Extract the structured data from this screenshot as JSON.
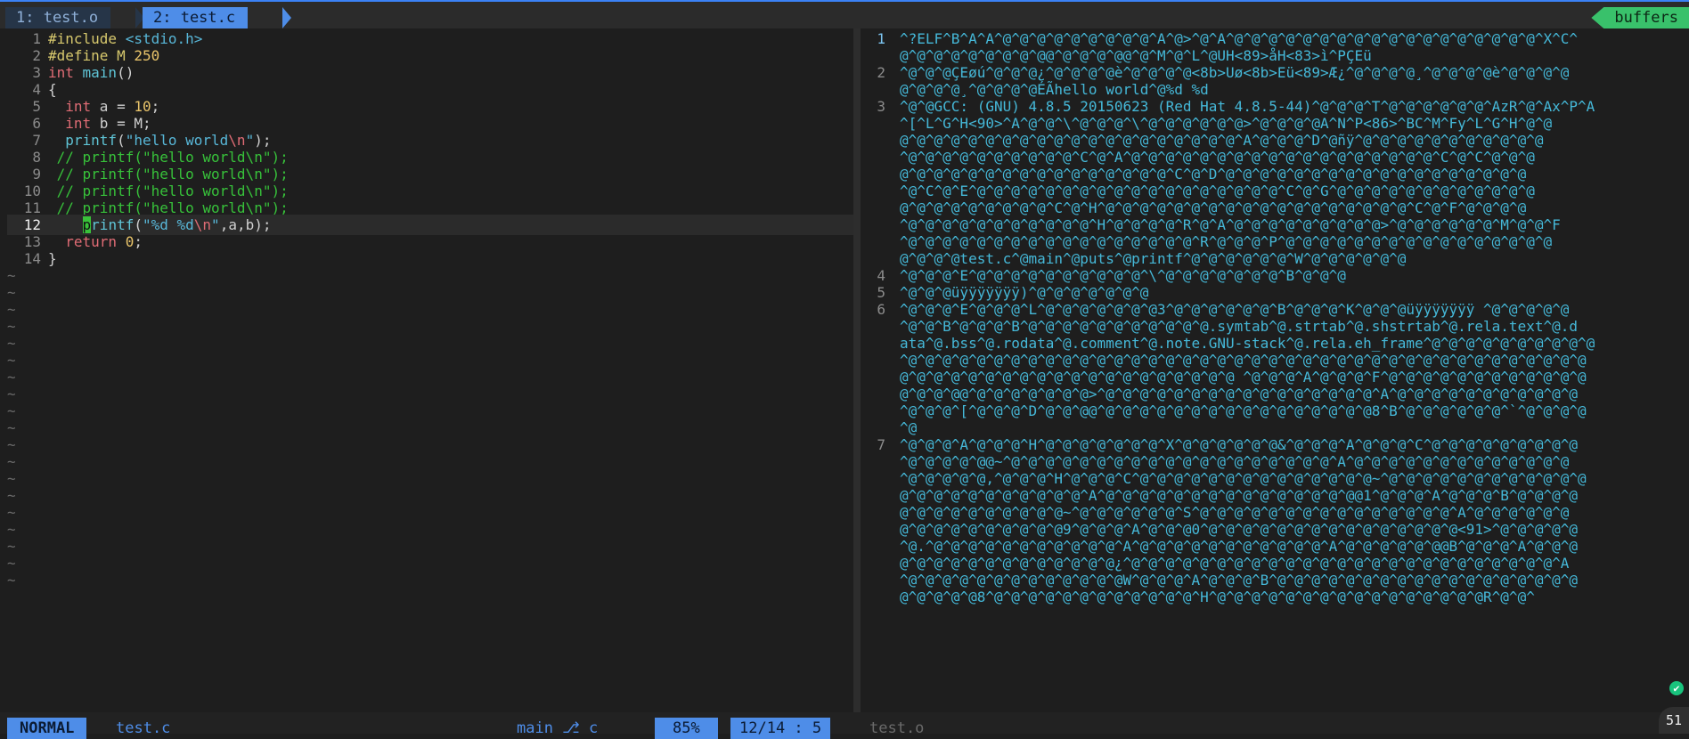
{
  "tabline": {
    "tab1_label": "1: test.o",
    "tab2_label": "2: test.c",
    "buffers_label": "buffers"
  },
  "left_pane": {
    "lines": [
      {
        "n": "1",
        "segs": [
          {
            "t": "#include ",
            "c": "pp"
          },
          {
            "t": "<stdio.h>",
            "c": "str"
          }
        ]
      },
      {
        "n": "2",
        "segs": [
          {
            "t": "#define M ",
            "c": "pp"
          },
          {
            "t": "250",
            "c": "num"
          }
        ]
      },
      {
        "n": "3",
        "segs": [
          {
            "t": "int ",
            "c": "kw"
          },
          {
            "t": "main",
            "c": "fn"
          },
          {
            "t": "()",
            "c": ""
          }
        ]
      },
      {
        "n": "4",
        "segs": [
          {
            "t": "{",
            "c": ""
          }
        ]
      },
      {
        "n": "5",
        "segs": [
          {
            "t": "  ",
            "c": ""
          },
          {
            "t": "int",
            "c": "kw"
          },
          {
            "t": " a = ",
            "c": ""
          },
          {
            "t": "10",
            "c": "num"
          },
          {
            "t": ";",
            "c": ""
          }
        ]
      },
      {
        "n": "6",
        "segs": [
          {
            "t": "  ",
            "c": ""
          },
          {
            "t": "int",
            "c": "kw"
          },
          {
            "t": " b = M;",
            "c": ""
          }
        ]
      },
      {
        "n": "7",
        "segs": [
          {
            "t": "  ",
            "c": ""
          },
          {
            "t": "printf",
            "c": "fn"
          },
          {
            "t": "(",
            "c": ""
          },
          {
            "t": "\"hello world",
            "c": "str"
          },
          {
            "t": "\\n",
            "c": "esc"
          },
          {
            "t": "\"",
            "c": "str"
          },
          {
            "t": ");",
            "c": ""
          }
        ]
      },
      {
        "n": "8",
        "segs": [
          {
            "t": " // printf(\"hello world\\n\");",
            "c": "cm"
          }
        ]
      },
      {
        "n": "9",
        "segs": [
          {
            "t": " // printf(\"hello world\\n\");",
            "c": "cm"
          }
        ]
      },
      {
        "n": "10",
        "segs": [
          {
            "t": " // printf(\"hello world\\n\");",
            "c": "cm"
          }
        ]
      },
      {
        "n": "11",
        "segs": [
          {
            "t": " // printf(\"hello world\\n\");",
            "c": "cm"
          }
        ]
      },
      {
        "n": "12",
        "cur": true,
        "segs": [
          {
            "t": "    ",
            "c": ""
          },
          {
            "t": "p",
            "c": "cur-block"
          },
          {
            "t": "rintf",
            "c": "fn"
          },
          {
            "t": "(",
            "c": ""
          },
          {
            "t": "\"%d %d",
            "c": "str"
          },
          {
            "t": "\\n",
            "c": "esc"
          },
          {
            "t": "\"",
            "c": "str"
          },
          {
            "t": ",a,b);",
            "c": ""
          }
        ]
      },
      {
        "n": "13",
        "segs": [
          {
            "t": "  ",
            "c": ""
          },
          {
            "t": "return ",
            "c": "kw"
          },
          {
            "t": "0",
            "c": "num"
          },
          {
            "t": ";",
            "c": ""
          }
        ]
      },
      {
        "n": "14",
        "segs": [
          {
            "t": "}",
            "c": ""
          }
        ]
      }
    ],
    "tilde_count": 19,
    "tilde_char": "~"
  },
  "right_pane": {
    "lines": [
      {
        "n": "1",
        "cur": true,
        "t": "^?ELF^B^A^A^@^@^@^@^@^@^@^@^@^A^@>^@^A^@^@^@^@^@^@^@^@^@^@^@^@^@^@^@^@^@^@^X^C^"
      },
      {
        "n": "",
        "t": "@^@^@^@^@^@^@^@^@@^@^@^@^@@^@^M^@^L^@UH<89>åH<83>ì^PÇEü"
      },
      {
        "n": "2",
        "t": "^@^@^@ÇEøú^@^@^@¿^@^@^@^@è^@^@^@^@<8b>Uø<8b>Eü<89>Æ¿^@^@^@^@¸^@^@^@^@è^@^@^@^@"
      },
      {
        "n": "",
        "t": "@^@^@^@¸^@^@^@^@ÉÃhello world^@%d %d"
      },
      {
        "n": "3",
        "t": "^@^@GCC: (GNU) 4.8.5 20150623 (Red Hat 4.8.5-44)^@^@^@^T^@^@^@^@^@^@^AzR^@^Ax^P^A"
      },
      {
        "n": "",
        "t": "^[^L^G^H<90>^A^@^@^\\^@^@^@^\\^@^@^@^@^@^@>^@^@^@^@A^N^P<86>^BC^M^Fy^L^G^H^@^@"
      },
      {
        "n": "",
        "t": "@^@^@^@^@^@^@^@^@^@^@^@^@^@^@^@^@^@^@^@^A^@^@^@^D^@ñÿ^@^@^@^@^@^@^@^@^@^@^@"
      },
      {
        "n": "",
        "t": "^@^@^@^@^@^@^@^@^@^@^C^@^A^@^@^@^@^@^@^@^@^@^@^@^@^@^@^@^@^@^@^C^@^C^@^@^@"
      },
      {
        "n": "",
        "t": "@^@^@^@^@^@^@^@^@^@^@^@^@^@^@^@^C^@^D^@^@^@^@^@^@^@^@^@^@^@^@^@^@^@^@^@^@"
      },
      {
        "n": "",
        "t": "^@^C^@^E^@^@^@^@^@^@^@^@^@^@^@^@^@^@^@^@^@^@^C^@^G^@^@^@^@^@^@^@^@^@^@^@^@"
      },
      {
        "n": "",
        "t": "@^@^@^@^@^@^@^@^@^C^@^H^@^@^@^@^@^@^@^@^@^@^@^@^@^@^@^@^@^@^C^@^F^@^@^@^@"
      },
      {
        "n": "",
        "t": "^@^@^@^@^@^@^@^@^@^@^@^H^@^@^@^@^R^@^A^@^@^@^@^@^@^@^@^@>^@^@^@^@^@^@^M^@^@^F"
      },
      {
        "n": "",
        "t": "^@^@^@^@^@^@^@^@^@^@^@^@^@^@^@^@^@^R^@^@^@^P^@^@^@^@^@^@^@^@^@^@^@^@^@^@^@^@"
      },
      {
        "n": "",
        "t": "@^@^@^@test.c^@main^@puts^@printf^@^@^@^@^@^@^W^@^@^@^@^@^@"
      },
      {
        "n": "4",
        "t": "^@^@^@^E^@^@^@^@^@^@^@^@^@^@^\\^@^@^@^@^@^@^@^B^@^@^@"
      },
      {
        "n": "5",
        "t": "^@^@^@üÿÿÿÿÿÿÿ)^@^@^@^@^@^@^@"
      },
      {
        "n": "6",
        "t": "^@^@^@^E^@^@^@^L^@^@^@^@^@^@^@3^@^@^@^@^@^@^B^@^@^@^K^@^@^@üÿÿÿÿÿÿÿ ^@^@^@^@^@"
      },
      {
        "n": "",
        "t": "^@^@^B^@^@^@^B^@^@^@^@^@^@^@^@^@^@^@.symtab^@.strtab^@.shstrtab^@.rela.text^@.d"
      },
      {
        "n": "",
        "t": "ata^@.bss^@.rodata^@.comment^@.note.GNU-stack^@.rela.eh_frame^@^@^@^@^@^@^@^@^@^@"
      },
      {
        "n": "",
        "t": "^@^@^@^@^@^@^@^@^@^@^@^@^@^@^@^@^@^@^@^@^@^@^@^@^@^@^@^@^@^@^@^@^@^@^@^@^@^@^@^@"
      },
      {
        "n": "",
        "t": "@^@^@^@^@^@^@^@^@^@^@^@^@^@^@^@^@^@^@^@ ^@^@^@^A^@^@^@^F^@^@^@^@^@^@^@^@^@^@^@^@"
      },
      {
        "n": "",
        "t": "@^@^@^@@^@^@^@^@^@^@^@>^@^@^@^@^@^@^@^@^@^@^@^@^@^@^@^@^A^@^@^@^@^@^@^@^@^@^@^@"
      },
      {
        "n": "",
        "t": "^@^@^@^[^@^@^@^D^@^@^@@^@^@^@^@^@^@^@^@^@^@^@^@^@^@^@^@8^B^@^@^@^@^@^@^`^@^@^@^@"
      },
      {
        "n": "",
        "t": "^@"
      },
      {
        "n": "7",
        "t": "^@^@^@^A^@^@^@^H^@^@^@^@^@^@^@^X^@^@^@^@^@^@&^@^@^@^A^@^@^@^C^@^@^@^@^@^@^@^@^@"
      },
      {
        "n": "",
        "t": "^@^@^@^@^@@~^@^@^@^@^@^@^@^@^@^@^@^@^@^@^@^@^@^@^@^A^@^@^@^@^@^@^@^@^@^@^@^@^@"
      },
      {
        "n": "",
        "t": "^@^@^@^@^@,^@^@^@^H^@^@^@^C^@^@^@^@^@^@^@^@^@^@^@^@^@^@~^@^@^@^@^@^@^@^@^@^@^@^@"
      },
      {
        "n": "",
        "t": "@^@^@^@^@^@^@^@^@^@^@^A^@^@^@^@^@^@^@^@^@^@^@^@^@^@^@@1^@^@^@^A^@^@^@^B^@^@^@^@"
      },
      {
        "n": "",
        "t": "@^@^@^@^@^@^@^@^@^@~^@^@^@^@^@^@^S^@^@^@^@^@^@^@^@^@^@^@^@^@^@^@^A^@^@^@^@^@^@"
      },
      {
        "n": "",
        "t": "@^@^@^@^@^@^@^@^@^@9^@^@^@^A^@^@^@0^@^@^@^@^@^@^@^@^@^@^@^@^@^@^@<91>^@^@^@^@^@"
      },
      {
        "n": "",
        "t": "^@.^@^@^@^@^@^@^@^@^@^@^@^A^@^@^@^@^@^@^@^@^@^@^@^A^@^@^@^@^@^@@B^@^@^@^A^@^@^@"
      },
      {
        "n": "",
        "t": "@^@^@^@^@^@^@^@^@^@^@^@^@¿^@^@^@^@^@^@^@^@^@^@^@^@^@^@^@^@^@^@^@^@^@^@^@^@^@^A"
      },
      {
        "n": "",
        "t": "^@^@^@^@^@^@^@^@^@^@^@^@^@W^@^@^@^A^@^@^@^B^@^@^@^@^@^@^@^@^@^@^@^@^@^@^@^@^@^@"
      },
      {
        "n": "",
        "t": "@^@^@^@^@8^@^@^@^@^@^@^@^@^@^@^@^@^H^@^@^@^@^@^@^@^@^@^@^@^@^@^@^@^@R^@^@^"
      }
    ]
  },
  "statusline": {
    "mode": "NORMAL",
    "filename": "test.c",
    "branch": "main ⎇ c",
    "percent": "85%",
    "position": "12/14 : 5",
    "right_filename": "test.o"
  },
  "overlay": {
    "avatar_text": "51",
    "check_glyph": "✔"
  }
}
